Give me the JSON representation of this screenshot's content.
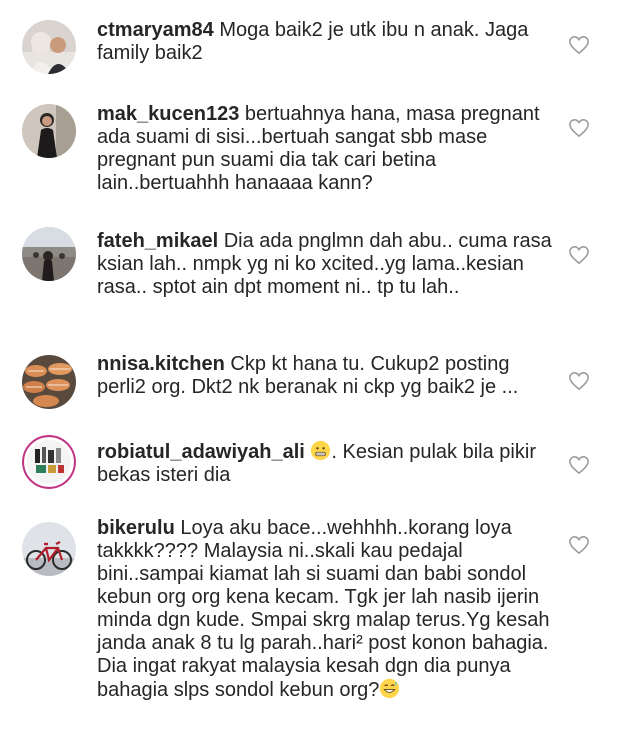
{
  "comments": [
    {
      "username": "ctmaryam84",
      "text": "Moga baik2 je utk ibu n anak. Jaga family baik2",
      "avatar": "avatar-two-people-hijab",
      "like_icon": "heart-outline-icon"
    },
    {
      "username": "mak_kucen123",
      "text": "bertuahnya hana, masa pregnant ada suami di sisi...bertuah sangat sbb mase pregnant pun suami dia tak cari betina lain..bertuahhh hanaaaa kann?",
      "avatar": "avatar-woman-black-dress",
      "like_icon": "heart-outline-icon"
    },
    {
      "username": "fateh_mikael",
      "text": "Dia ada pnglmn dah abu.. cuma rasa ksian lah.. nmpk yg ni ko xcited..yg lama..kesian rasa.. sptot ain dpt moment ni.. tp tu lah..",
      "avatar": "avatar-person-outdoors",
      "like_icon": "heart-outline-icon"
    },
    {
      "username": "nnisa.kitchen",
      "text": "Ckp kt hana tu. Cukup2 posting perli2 org. Dkt2 nk beranak ni ckp yg baik2 je ...",
      "avatar": "avatar-food-rolls",
      "like_icon": "heart-outline-icon"
    },
    {
      "username": "robiatul_adawiyah_ali",
      "emoji": "grimacing-face-emoji",
      "text": ". Kesian pulak bila pikir bekas isteri dia",
      "avatar": "avatar-products-story-ring",
      "like_icon": "heart-outline-icon"
    },
    {
      "username": "bikerulu",
      "text": "Loya aku bace...wehhhh..korang loya takkkk???? Malaysia ni..skali kau pedajal bini..sampai kiamat lah si suami dan babi sondol kebun org org kena kecam. Tgk jer lah nasib ijerin minda dgn kude. Smpai skrg malap terus.Yg kesah janda anak 8 tu lg parah..hari² post konon bahagia. Dia ingat rakyat malaysia kesah dgn dia punya bahagia slps sondol kebun org?",
      "trailing_emoji": "grinning-sweat-emoji",
      "avatar": "avatar-bicycle",
      "like_icon": "heart-outline-icon"
    }
  ]
}
